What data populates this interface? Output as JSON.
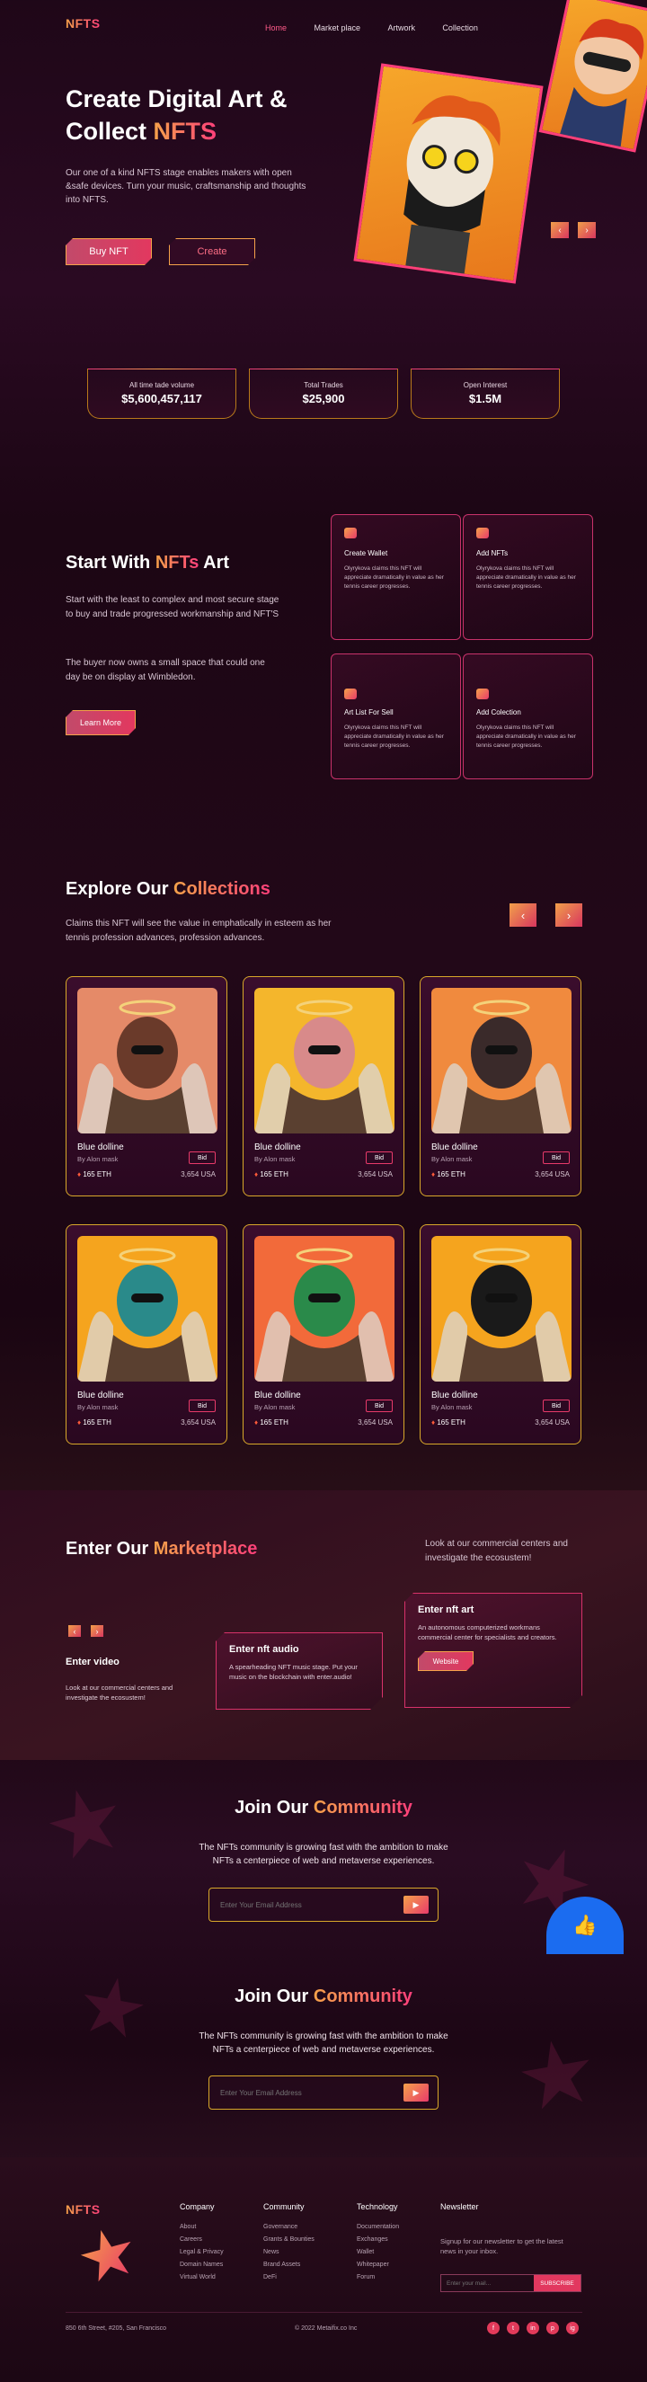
{
  "brand": {
    "logo": "NFTS"
  },
  "nav": {
    "items": [
      "Home",
      "Market place",
      "Artwork",
      "Collection"
    ],
    "active": "Home"
  },
  "hero": {
    "title_line1": "Create Digital Art &",
    "title_line2_prefix": "Collect ",
    "title_line2_highlight": "NFTS",
    "description": "Our one of a kind NFTS stage enables makers with open &safe devices. Turn your music, craftsmanship and thoughts into NFTS.",
    "buy_label": "Buy NFT",
    "create_label": "Create",
    "prev_icon": "‹",
    "next_icon": "›"
  },
  "stats": [
    {
      "label": "All time tade volume",
      "value": "$5,600,457,117"
    },
    {
      "label": "Total Trades",
      "value": "$25,900"
    },
    {
      "label": "Open Interest",
      "value": "$1.5M"
    }
  ],
  "start": {
    "title_prefix": "Start With ",
    "title_highlight": "NFTs",
    "title_suffix": " Art",
    "para1": "Start with the  least to complex and most secure stage to buy and trade progressed workmanship and NFT'S",
    "para2": "The buyer now owns a small space that could one day be on display at Wimbledon.",
    "learn_more": "Learn More",
    "features": [
      {
        "title": "Create Wallet",
        "text": "Olyrykova claims this NFT will appreciate dramatically in value as her tennis career progresses."
      },
      {
        "title": "Add NFTs",
        "text": "Olyrykova claims this NFT will appreciate dramatically in value as her tennis career progresses."
      },
      {
        "title": "Art List For Sell",
        "text": "Olyrykova claims this NFT will appreciate dramatically in value as her tennis career progresses."
      },
      {
        "title": "Add Colection",
        "text": "Olyrykova claims this NFT will appreciate dramatically in value as her tennis career progresses."
      }
    ]
  },
  "collections": {
    "title_prefix": "Explore Our ",
    "title_highlight": "Collections",
    "description": "Claims this NFT will see the value in emphatically in esteem as her tennis profession advances, profession advances.",
    "prev_icon": "‹",
    "next_icon": "›",
    "cards": [
      {
        "name": "Blue dolline",
        "by": "By Alon mask",
        "price": "165 ETH",
        "usd": "3,654 USA",
        "bid": "Bid",
        "bg": "#e58a68"
      },
      {
        "name": "Blue dolline",
        "by": "By Alon mask",
        "price": "165 ETH",
        "usd": "3,654 USA",
        "bid": "Bid",
        "bg": "#f4b62c"
      },
      {
        "name": "Blue dolline",
        "by": "By Alon mask",
        "price": "165 ETH",
        "usd": "3,654 USA",
        "bid": "Bid",
        "bg": "#f08a3e"
      },
      {
        "name": "Blue dolline",
        "by": "By Alon mask",
        "price": "165 ETH",
        "usd": "3,654 USA",
        "bid": "Bid",
        "bg": "#f5a41e"
      },
      {
        "name": "Blue dolline",
        "by": "By Alon mask",
        "price": "165 ETH",
        "usd": "3,654 USA",
        "bid": "Bid",
        "bg": "#f26a3a"
      },
      {
        "name": "Blue dolline",
        "by": "By Alon mask",
        "price": "165 ETH",
        "usd": "3,654 USA",
        "bid": "Bid",
        "bg": "#f5a41e"
      }
    ]
  },
  "marketplace": {
    "title_prefix": "Enter Our ",
    "title_highlight": "Marketplace",
    "side_text": "Look at our commercial centers and investigate the ecosustem!",
    "video_title": "Enter video",
    "video_text": "Look at our commercial centers and investigate the ecosustem!",
    "audio_title": "Enter nft audio",
    "audio_text": "A spearheading NFT music stage. Put your music on the blockchain with enter.audio!",
    "art_title": "Enter nft art",
    "art_text": "An autonomous computerized workmans commercial center for specialists and creators.",
    "website_label": "Website",
    "prev_icon": "‹",
    "next_icon": "›"
  },
  "community": {
    "title_prefix": "Join Our ",
    "title_highlight": "Community",
    "description_line1": "The NFTs community is growing fast with the ambition to make",
    "description_line2": "NFTs a centerpiece of web and metaverse experiences.",
    "email_placeholder": "Enter Your Email Address",
    "send_icon": "▶",
    "like_icon": "👍"
  },
  "footer": {
    "logo": "NFTS",
    "columns": [
      {
        "title": "Company",
        "links": [
          "About",
          "Careers",
          "Legal & Privacy",
          "Domain Names",
          "Virtual World"
        ]
      },
      {
        "title": "Community",
        "links": [
          "Governance",
          "Grants & Bounties",
          "News",
          "Brand Assets",
          "DeFi"
        ]
      },
      {
        "title": "Technology",
        "links": [
          "Documentation",
          "Exchanges",
          "Wallet",
          "Whitepaper",
          "Forum"
        ]
      }
    ],
    "newsletter_title": "Newsletter",
    "newsletter_text": "Signup for our newsletter to get the latest news in your inbox.",
    "newsletter_placeholder": "Enter your mail...",
    "subscribe_label": "SUBSCRIBE",
    "address": "850 6th Street, #205, San Francisco",
    "copyright": "© 2022 Metaifix.co Inc",
    "socials": [
      "f",
      "t",
      "in",
      "p",
      "ig"
    ]
  }
}
